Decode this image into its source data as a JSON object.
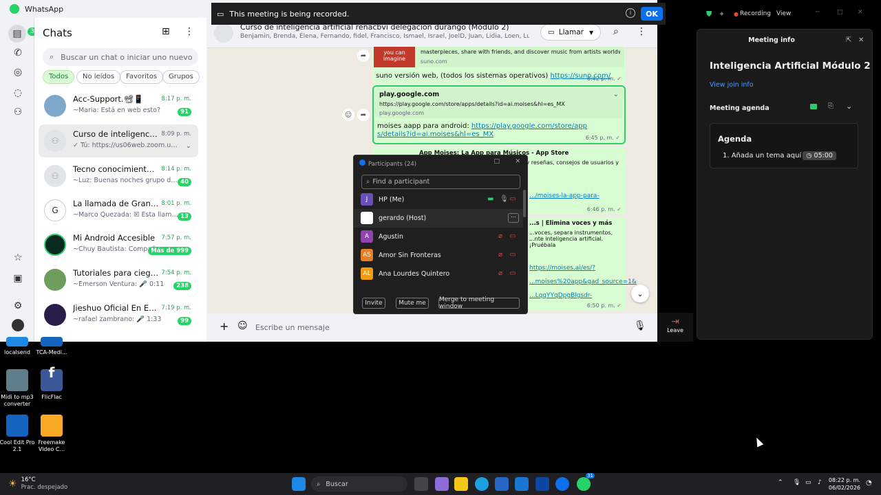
{
  "whatsapp": {
    "app_title": "WhatsApp",
    "rail_badge": "31",
    "chats_title": "Chats",
    "search_placeholder": "Buscar un chat o iniciar uno nuevo",
    "filters": [
      "Todos",
      "No leídos",
      "Favoritos",
      "Grupos"
    ],
    "chats": [
      {
        "name": "Acc-Support.📽📱",
        "preview": "~Maria: Está en web esto?",
        "time": "8:17 p. m.",
        "badge": "91"
      },
      {
        "name": "Curso de inteligencia artifi...",
        "preview": "✓ Tú: https://us06web.zoom.us/j/...",
        "time": "8:09 p. m.",
        "badge": ""
      },
      {
        "name": "Tecno conocimiento TCA",
        "preview": "~Luz: Buenas noches grupo de tec...",
        "time": "8:14 p. m.",
        "badge": "40"
      },
      {
        "name": "La llamada de Grandes Jo...",
        "preview": "~Marco Quezada: ☒ Esta llamad...",
        "time": "8:01 p. m.",
        "badge": "13"
      },
      {
        "name": "Mi Android Accesible",
        "preview": "~Chuy Bautista: Compañer...",
        "time": "7:57 p. m.",
        "badge": "Más de 999"
      },
      {
        "name": "Tutoriales para ciegos",
        "preview": "~Emerson Ventura: 🎤 0:11",
        "time": "7:54 p. m.",
        "badge": "238"
      },
      {
        "name": "Jieshuo Oficial En Español",
        "preview": "~rafael zambrano: 🎤 1:33",
        "time": "7:19 p. m.",
        "badge": "99"
      }
    ],
    "conversation": {
      "title": "Curso de inteligencia artificial renacbvi delegacion durango (Módulo 2)",
      "members": "Benjamin, Brenda, Elena, Fernando, fidel, Francisco, Ismael, Israel, JoelD, Juan, Lidia, Loen, Lupillo, marlene, ...",
      "call_label": "Llamar",
      "composer_placeholder": "Escribe un mensaje",
      "messages": [
        {
          "preview_img_text": "you can imagine",
          "preview_desc": "masterpieces, share with friends, and discover music from artists worldwide.",
          "preview_domain": "suno.com",
          "text": "suno versión web, (todos los sistemas operativos) ",
          "link": "https://suno.com/",
          "time": "6:42 p. m. ✓"
        },
        {
          "preview_title": "play.google.com",
          "preview_desc": "https://play.google.com/store/apps/details?id=ai.moises&hl=es_MX",
          "preview_domain": "play.google.com",
          "text": "moises aapp para android: ",
          "link": "https://play.google.com/store/apps/details?id=ai.moises&hl=es_MX",
          "time": "6:45 p. m. ✓"
        },
        {
          "preview_title": "App Moises: La App para Músicos - App Store",
          "preview_desc": "...Moises Systems, Inc en App Store. ...y reseñas, consejos de usuarios y",
          "link": ".../moises-la-app-para-",
          "time": "6:46 p. m. ✓"
        },
        {
          "preview_title": "...s | Elimina voces y más",
          "preview_desc": "...voces, separa instrumentos, ...nte inteligencia artificial. ¡Pruébala",
          "link": "https://moises.ai/es/? ...moises%20app&gad_source=1& ...LqqYYqDpgBlgsdr-",
          "time": "6:50 p. m. ✓"
        }
      ]
    }
  },
  "zoom": {
    "recording_banner": "This meeting is being recorded.",
    "ok_label": "OK",
    "recording_label": "Recording",
    "view_label": "View",
    "participants": {
      "title": "Participants (24)",
      "search_placeholder": "Find a participant",
      "list": [
        {
          "initial": "J",
          "name": "HP (Me)",
          "color": "#6b4fbb"
        },
        {
          "initial": "",
          "name": "gerardo (Host)",
          "color": "#ffffff"
        },
        {
          "initial": "A",
          "name": "Agustin",
          "color": "#8e44ad"
        },
        {
          "initial": "AS",
          "name": "Amor Sin Fronteras",
          "color": "#e67e22"
        },
        {
          "initial": "AL",
          "name": "Ana Lourdes Quintero",
          "color": "#f39c12"
        }
      ],
      "buttons": [
        "Invite",
        "Mute me",
        "Merge to meeting window"
      ]
    },
    "leave_label": "Leave",
    "meeting_info": {
      "header": "Meeting info",
      "title": "Inteligencia Artificial Módulo 2",
      "join_link": "View join info",
      "agenda_label": "Meeting agenda",
      "agenda_title": "Agenda",
      "agenda_item": "1.  Añada un tema aquí",
      "agenda_time": "◷ 05:00"
    }
  },
  "desktop": {
    "icons": [
      {
        "label": "localsend",
        "color": "#1e88e5"
      },
      {
        "label": "TCA-Medi...",
        "color": "#1565c0"
      },
      {
        "label": "Midi to mp3 converter",
        "color": "#607d8b"
      },
      {
        "label": "FlicFlac",
        "color": "#3b5998"
      },
      {
        "label": "Cool Edit Pro 2.1",
        "color": "#1565c0"
      },
      {
        "label": "Freemake Video C...",
        "color": "#f9a825"
      }
    ]
  },
  "taskbar": {
    "temp": "16°C",
    "weather": "Prac. despejado",
    "search_label": "Buscar",
    "badge": "31",
    "time": "08:22 p. m.",
    "date": "06/02/2026"
  },
  "colors": {
    "wa_green": "#25d366",
    "zoom_blue": "#0e71eb",
    "bubble": "#d9fdd3"
  }
}
